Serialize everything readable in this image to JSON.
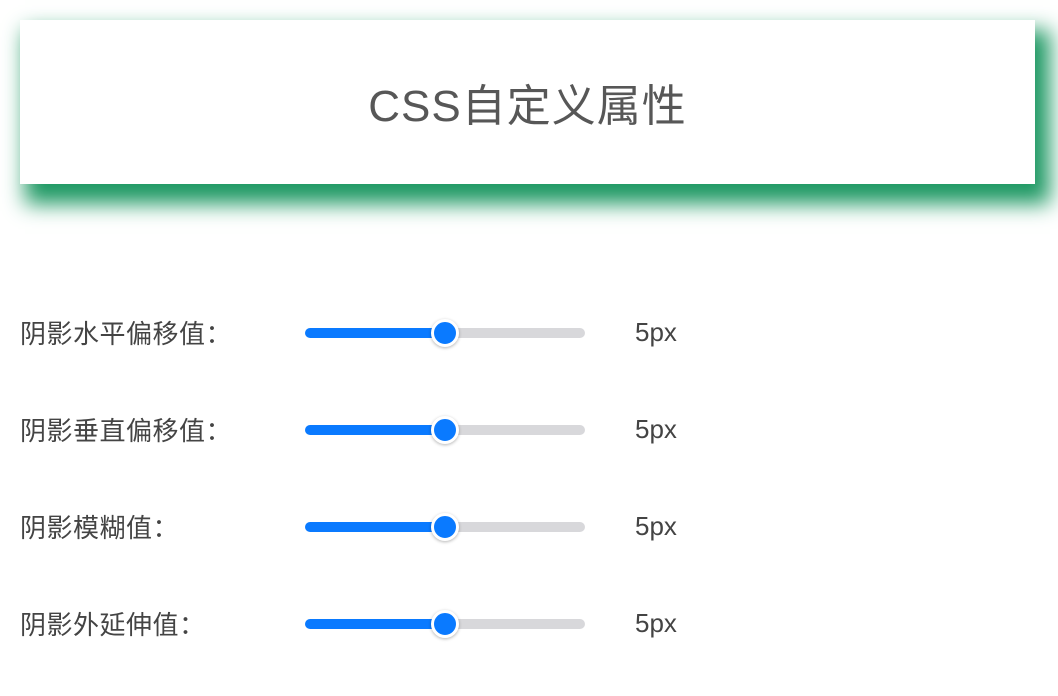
{
  "header": {
    "title": "CSS自定义属性"
  },
  "sliders": [
    {
      "label": "阴影水平偏移值：",
      "value_display": "5px",
      "value": 5,
      "min": 0,
      "max": 10
    },
    {
      "label": "阴影垂直偏移值：",
      "value_display": "5px",
      "value": 5,
      "min": 0,
      "max": 10
    },
    {
      "label": "阴影模糊值：",
      "value_display": "5px",
      "value": 5,
      "min": 0,
      "max": 10
    },
    {
      "label": "阴影外延伸值：",
      "value_display": "5px",
      "value": 5,
      "min": 0,
      "max": 10
    }
  ]
}
